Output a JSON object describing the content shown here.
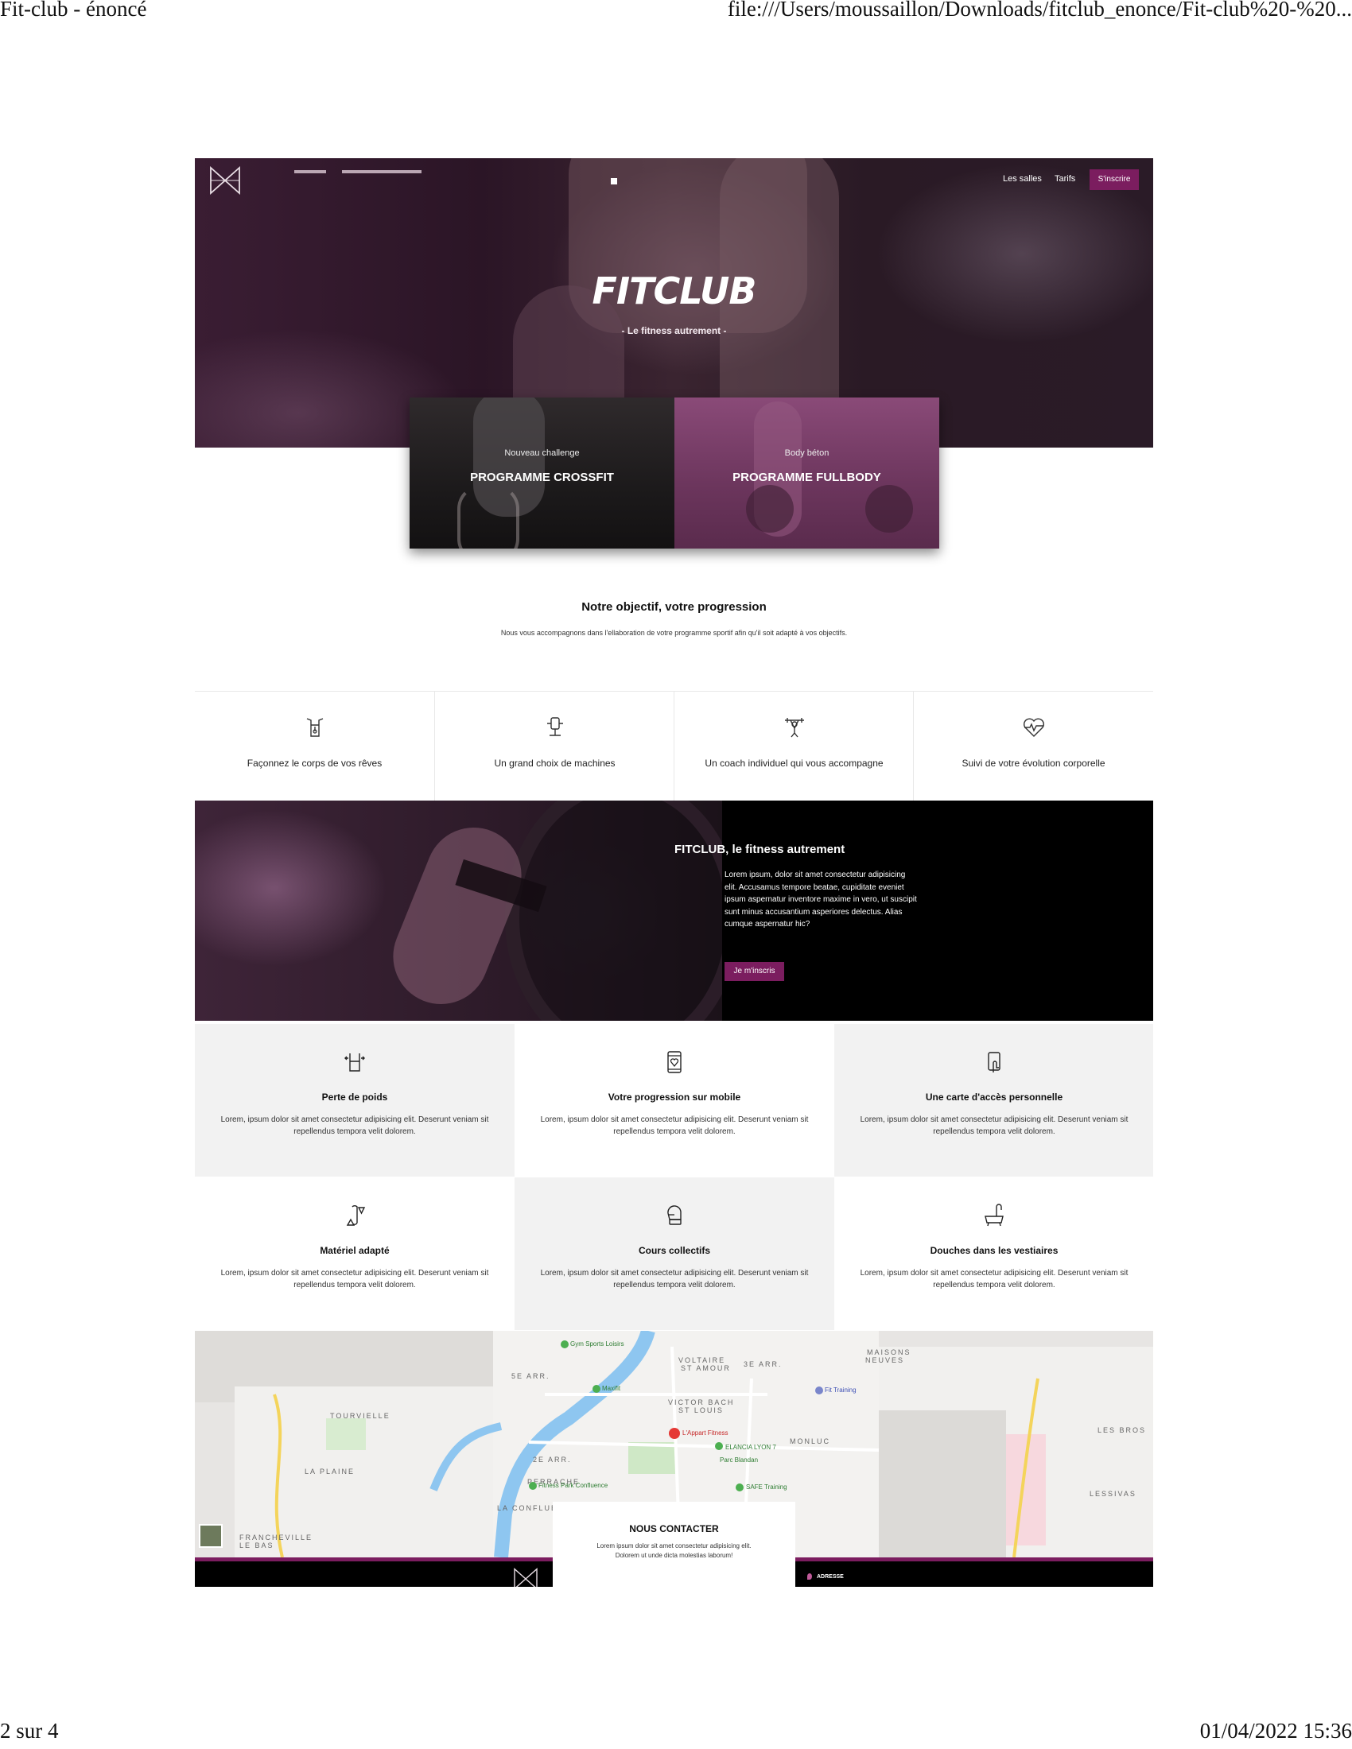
{
  "print": {
    "title": "Fit-club - énoncé",
    "url": "file:///Users/moussaillon/Downloads/fitclub_enonce/Fit-club%20-%20...",
    "page": "2 sur 4",
    "datetime": "01/04/2022 15:36"
  },
  "nav": {
    "items": [
      "Les salles",
      "Tarifs"
    ],
    "cta": "S'inscrire"
  },
  "hero": {
    "title": "FITCLUB",
    "tagline": "- Le fitness autrement -"
  },
  "programs": [
    {
      "subtitle": "Nouveau challenge",
      "title": "PROGRAMME CROSSFIT"
    },
    {
      "subtitle": "Body béton",
      "title": "PROGRAMME FULLBODY"
    }
  ],
  "objective": {
    "title": "Notre objectif, votre progression",
    "text": "Nous vous accompagnons dans l'ellaboration de votre programme sportif afin qu'il soit adapté à vos objectifs."
  },
  "features": [
    {
      "icon": "body-icon",
      "label": "Façonnez le corps de vos rêves"
    },
    {
      "icon": "machine-icon",
      "label": "Un grand choix de machines"
    },
    {
      "icon": "coach-icon",
      "label": "Un coach individuel qui vous accompagne"
    },
    {
      "icon": "heart-pulse-icon",
      "label": "Suivi de votre évolution corporelle"
    }
  ],
  "about": {
    "title": "FITCLUB, le fitness autrement",
    "text": "Lorem ipsum, dolor sit amet consectetur adipisicing elit. Accusamus tempore beatae, cupiditate eveniet ipsum aspernatur inventore maxime in vero, ut suscipit sunt minus accusantium asperiores delectus. Alias cumque aspernatur hic?",
    "button": "Je m'inscris"
  },
  "advantages": [
    {
      "icon": "weight-loss-icon",
      "title": "Perte de poids",
      "text": "Lorem, ipsum dolor sit amet consectetur adipisicing elit. Deserunt veniam sit repellendus tempora velit dolorem."
    },
    {
      "icon": "mobile-heart-icon",
      "title": "Votre progression sur mobile",
      "text": "Lorem, ipsum dolor sit amet consectetur adipisicing elit. Deserunt veniam sit repellendus tempora velit dolorem."
    },
    {
      "icon": "access-card-icon",
      "title": "Une carte d'accès personnelle",
      "text": "Lorem, ipsum dolor sit amet consectetur adipisicing elit. Deserunt veniam sit repellendus tempora velit dolorem."
    },
    {
      "icon": "equipment-icon",
      "title": "Matériel adapté",
      "text": "Lorem, ipsum dolor sit amet consectetur adipisicing elit. Deserunt veniam sit repellendus tempora velit dolorem."
    },
    {
      "icon": "boxing-glove-icon",
      "title": "Cours collectifs",
      "text": "Lorem, ipsum dolor sit amet consectetur adipisicing elit. Deserunt veniam sit repellendus tempora velit dolorem."
    },
    {
      "icon": "shower-icon",
      "title": "Douches dans les vestiaires",
      "text": "Lorem, ipsum dolor sit amet consectetur adipisicing elit. Deserunt veniam sit repellendus tempora velit dolorem."
    }
  ],
  "map": {
    "districts": [
      "5E ARR.",
      "VOLTAIRE",
      "ST AMOUR",
      "3E ARR.",
      "MAISONS",
      "NEUVES",
      "TOURVIELLE",
      "VICTOR BACH",
      "ST LOUIS",
      "MONLUC",
      "LA PLAINE",
      "2E ARR.",
      "PERRACHE",
      "LA CONFLUEN",
      "FRANCHEVILLE",
      "LE BAS",
      "LES BROS",
      "LESSIVAS"
    ],
    "places": [
      "Gym Sports Loisirs",
      "Maxifit",
      "L'Appart Fitness",
      "ELANCIA LYON 7",
      "Parc Blandan",
      "Fit Training",
      "Fitness Park Confluence",
      "SAFE Training"
    ]
  },
  "contact": {
    "title": "NOUS CONTACTER",
    "text": "Lorem ipsum dolor sit amet consectetur adipisicing elit. Dolorem ut unde dicta molestias laborum!"
  },
  "footer": {
    "address_label": "ADRESSE"
  },
  "colors": {
    "brand": "#7b1d5f",
    "dark": "#000000",
    "gray_panel": "#f2f2f2"
  }
}
